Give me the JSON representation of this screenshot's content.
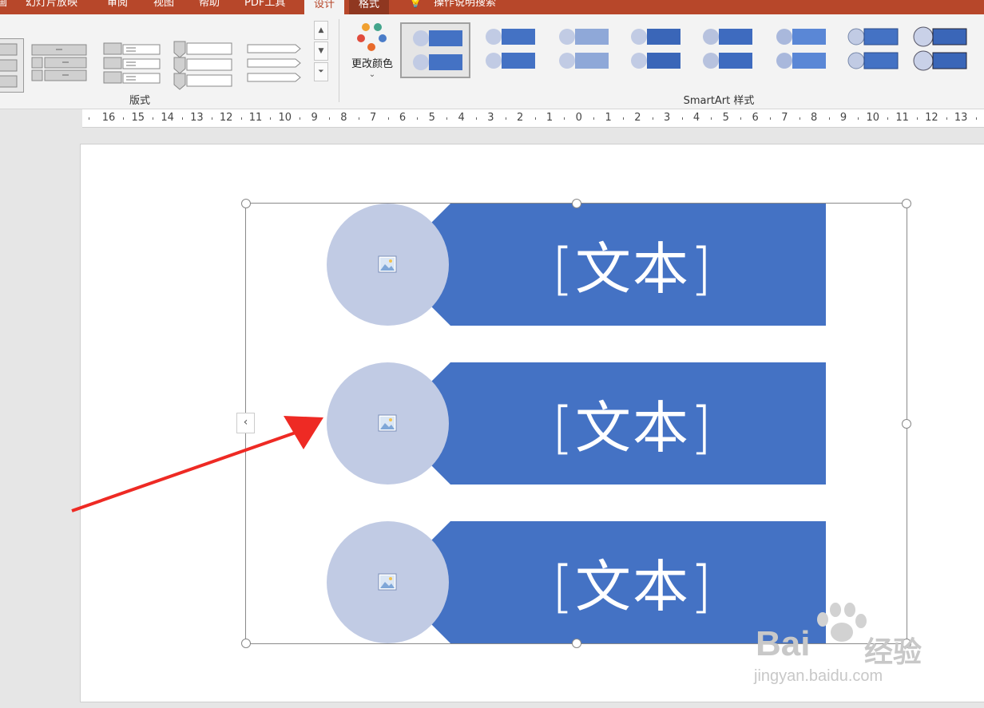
{
  "tabs": {
    "items": [
      "幻灯片放映",
      "审阅",
      "视图",
      "帮助",
      "PDF工具"
    ],
    "active": "设计",
    "format": "格式",
    "tell_me": "操作说明搜索"
  },
  "ribbon": {
    "layout_group_label": "版式",
    "change_colors_label": "更改颜色",
    "styles_group_label": "SmartArt 样式"
  },
  "ruler": {
    "numbers": [
      "16",
      "15",
      "14",
      "13",
      "12",
      "11",
      "10",
      "9",
      "8",
      "7",
      "6",
      "5",
      "4",
      "3",
      "2",
      "1",
      "0",
      "1",
      "2",
      "3",
      "4",
      "5",
      "6",
      "7",
      "8",
      "9",
      "10",
      "11",
      "12",
      "13"
    ]
  },
  "slide": {
    "items": [
      {
        "text": "[文本]"
      },
      {
        "text": "[文本]"
      },
      {
        "text": "[文本]"
      }
    ]
  },
  "colors": {
    "accent": "#b7472a",
    "banner": "#4472c4",
    "circle": "#c1cbe4",
    "arrow": "#ee2a24"
  },
  "watermark": {
    "brand": "Bai",
    "brand_suffix": "经验",
    "url": "jingyan.baidu.com"
  }
}
